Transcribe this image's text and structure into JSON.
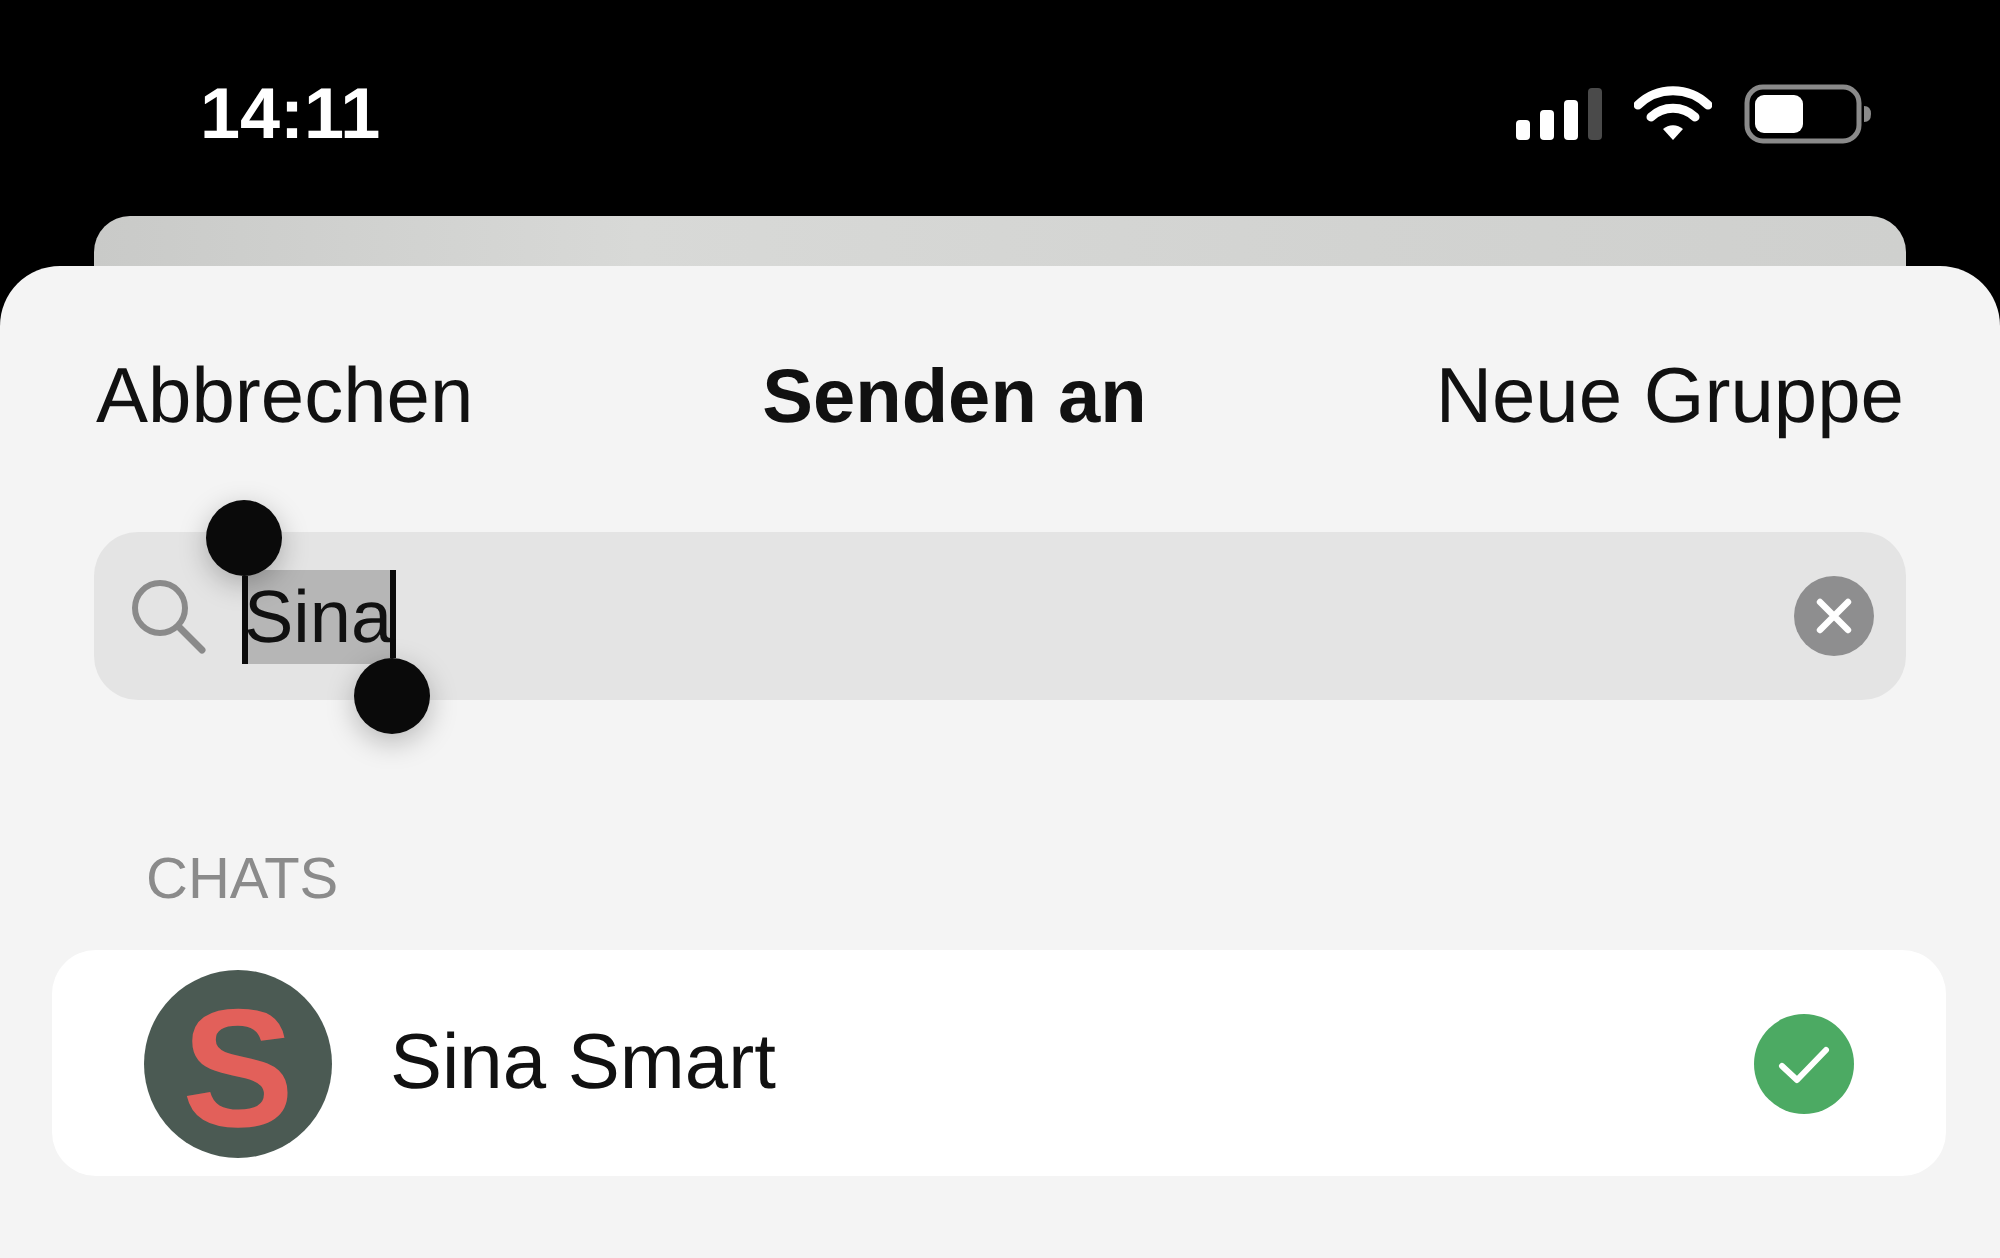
{
  "status_bar": {
    "time": "14:11"
  },
  "sheet": {
    "header": {
      "cancel": "Abbrechen",
      "title": "Senden an",
      "action": "Neue Gruppe"
    },
    "search": {
      "value": "Sina",
      "text_selected": true
    },
    "sections": [
      {
        "title": "CHATS",
        "items": [
          {
            "name": "Sina Smart",
            "avatar_letter": "S",
            "selected": true
          }
        ]
      }
    ]
  }
}
